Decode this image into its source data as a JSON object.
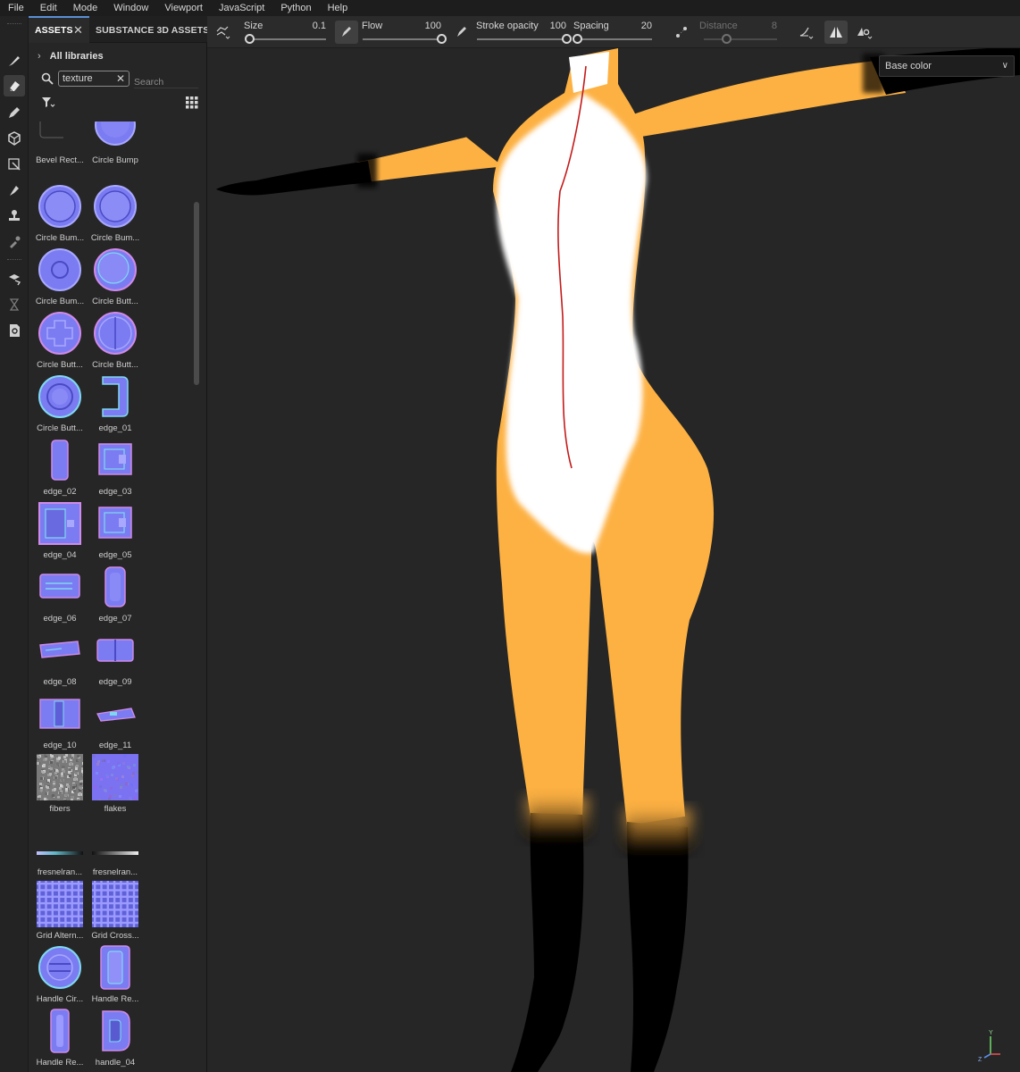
{
  "menu": [
    "File",
    "Edit",
    "Mode",
    "Window",
    "Viewport",
    "JavaScript",
    "Python",
    "Help"
  ],
  "panel": {
    "tabs": [
      {
        "label": "ASSETS",
        "close": "✕"
      },
      {
        "label": "SUBSTANCE 3D ASSETS"
      }
    ],
    "breadcrumb": {
      "chevron": "›",
      "label": "All libraries"
    },
    "search": {
      "tag": "texture",
      "tag_close": "✕",
      "placeholder": "Search"
    }
  },
  "assets": [
    {
      "name": "Bevel Rect...",
      "icon": "bevel-rect"
    },
    {
      "name": "Circle Bump",
      "icon": "circle-bump"
    },
    {
      "name": "Circle Bum...",
      "icon": "circle-bump-ring"
    },
    {
      "name": "Circle Bum...",
      "icon": "circle-bump-ring"
    },
    {
      "name": "Circle Bum...",
      "icon": "circle-bump-inner"
    },
    {
      "name": "Circle Butt...",
      "icon": "circle-button"
    },
    {
      "name": "Circle Butt...",
      "icon": "circle-button-dpad"
    },
    {
      "name": "Circle Butt...",
      "icon": "circle-button-split"
    },
    {
      "name": "Circle Butt...",
      "icon": "circle-button-ring"
    },
    {
      "name": "edge_01",
      "icon": "edge-bracket"
    },
    {
      "name": "edge_02",
      "icon": "edge-pill"
    },
    {
      "name": "edge_03",
      "icon": "edge-square"
    },
    {
      "name": "edge_04",
      "icon": "edge-frame"
    },
    {
      "name": "edge_05",
      "icon": "edge-square"
    },
    {
      "name": "edge_06",
      "icon": "edge-slot"
    },
    {
      "name": "edge_07",
      "icon": "edge-capsule"
    },
    {
      "name": "edge_08",
      "icon": "edge-bar"
    },
    {
      "name": "edge_09",
      "icon": "edge-double"
    },
    {
      "name": "edge_10",
      "icon": "edge-book"
    },
    {
      "name": "edge_11",
      "icon": "edge-bar-small"
    },
    {
      "name": "fibers",
      "icon": "noise-gray"
    },
    {
      "name": "flakes",
      "icon": "noise-blue"
    },
    {
      "name": "fresnelran...",
      "icon": "gradient-line"
    },
    {
      "name": "fresnelran...",
      "icon": "gradient-line-white"
    },
    {
      "name": "Grid Altern...",
      "icon": "grid"
    },
    {
      "name": "Grid Cross...",
      "icon": "grid"
    },
    {
      "name": "Handle Cir...",
      "icon": "handle-circle"
    },
    {
      "name": "Handle Re...",
      "icon": "handle-rect"
    },
    {
      "name": "Handle Re...",
      "icon": "handle-rect-narrow"
    },
    {
      "name": "handle_04",
      "icon": "handle-d"
    }
  ],
  "brush": {
    "size": {
      "label": "Size",
      "value": "0.1",
      "fraction": 0.0
    },
    "flow": {
      "label": "Flow",
      "value": "100",
      "fraction": 1.0
    },
    "stroke_opacity": {
      "label": "Stroke opacity",
      "value": "100",
      "fraction": 1.0
    },
    "spacing": {
      "label": "Spacing",
      "value": "20",
      "fraction": 0.0
    },
    "distance": {
      "label": "Distance",
      "value": "8",
      "fraction": 0.0,
      "disabled": true
    }
  },
  "viewport": {
    "channel": "Base color",
    "colors": {
      "fur": "#fdb143",
      "belly": "#ffffff",
      "socks": "#000000",
      "background": "#262626",
      "seam": "#c41a1a"
    },
    "axis_labels": {
      "y": "Y",
      "z": "Z"
    }
  }
}
